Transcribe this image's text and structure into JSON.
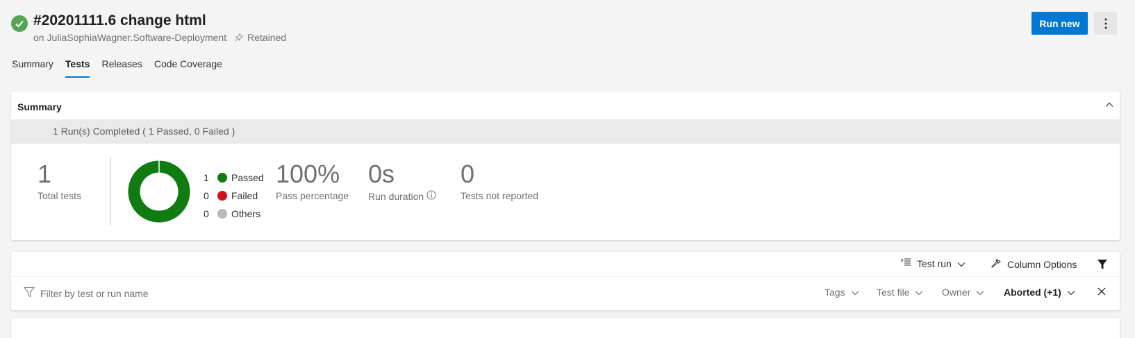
{
  "header": {
    "status_icon": "check-circle-icon",
    "status_color": "#53a653",
    "title": "#20201111.6 change html",
    "source": "on JuliaSophiaWagner.Software-Deployment",
    "retained": "Retained"
  },
  "actions": {
    "run_new": "Run new",
    "more_icon": "more-vertical-icon"
  },
  "tabs": [
    {
      "label": "Summary",
      "active": false
    },
    {
      "label": "Tests",
      "active": true
    },
    {
      "label": "Releases",
      "active": false
    },
    {
      "label": "Code Coverage",
      "active": false
    }
  ],
  "summary": {
    "heading": "Summary",
    "runs_completed": "1 Run(s) Completed ( 1 Passed, 0 Failed )",
    "total_tests": {
      "value": "1",
      "label": "Total tests"
    },
    "legend": [
      {
        "count": "1",
        "label": "Passed",
        "color": "#107c10"
      },
      {
        "count": "0",
        "label": "Failed",
        "color": "#d0101a"
      },
      {
        "count": "0",
        "label": "Others",
        "color": "#b8b8b8"
      }
    ],
    "pass_percentage": {
      "value": "100%",
      "label": "Pass percentage"
    },
    "run_duration": {
      "value": "0s",
      "label": "Run duration"
    },
    "not_reported": {
      "value": "0",
      "label": "Tests not reported"
    },
    "passed_fraction": 1.0
  },
  "tests": {
    "group_by": "Test run",
    "column_options": "Column Options",
    "filter_placeholder": "Filter by test or run name",
    "filters": {
      "tags": "Tags",
      "test_file": "Test file",
      "owner": "Owner",
      "outcome": "Aborted (+1)"
    }
  },
  "colors": {
    "accent": "#0078d4",
    "passed": "#107c10"
  }
}
